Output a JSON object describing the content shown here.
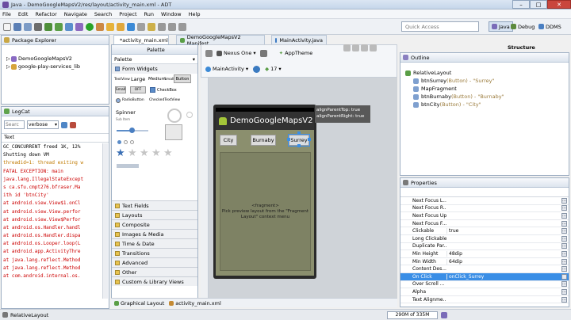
{
  "window": {
    "title": "Java - DemoGoogleMapsV2/res/layout/activity_main.xml - ADT"
  },
  "menu": [
    "File",
    "Edit",
    "Refactor",
    "Navigate",
    "Search",
    "Project",
    "Run",
    "Window",
    "Help"
  ],
  "quick_access": {
    "placeholder": "Quick Access"
  },
  "perspectives": {
    "java": "Java",
    "debug": "Debug",
    "ddms": "DDMS"
  },
  "package_explorer": {
    "title": "Package Explorer",
    "items": [
      "DemoGoogleMapsV2",
      "google-play-services_lib"
    ]
  },
  "logcat": {
    "title": "LogCat",
    "search_placeholder": "Searc",
    "level": "verbose",
    "column": "Text",
    "lines": [
      {
        "text": "GC_CONCURRENT freed 1K, 12%",
        "color": "#000000"
      },
      {
        "text": "Shutting down VM",
        "color": "#000000"
      },
      {
        "text": "threadid=1: thread exiting w",
        "color": "#c07a00"
      },
      {
        "text": "FATAL EXCEPTION: main",
        "color": "#cc0000"
      },
      {
        "text": "java.lang.IllegalStateExcept",
        "color": "#cc0000"
      },
      {
        "text": "s ca.sfu.cmpt276.bfraser.Ma",
        "color": "#cc0000"
      },
      {
        "text": "ith id 'btnCity'",
        "color": "#cc0000"
      },
      {
        "text": "at android.view.View$1.onCl",
        "color": "#cc0000"
      },
      {
        "text": "at android.view.View.perfor",
        "color": "#cc0000"
      },
      {
        "text": "at android.view.View$Perfor",
        "color": "#cc0000"
      },
      {
        "text": "at android.os.Handler.handl",
        "color": "#cc0000"
      },
      {
        "text": "at android.os.Handler.dispa",
        "color": "#cc0000"
      },
      {
        "text": "at android.os.Looper.loop(L",
        "color": "#cc0000"
      },
      {
        "text": "at android.app.ActivityThre",
        "color": "#cc0000"
      },
      {
        "text": "at java.lang.reflect.Method",
        "color": "#cc0000"
      },
      {
        "text": "at java.lang.reflect.Method",
        "color": "#cc0000"
      },
      {
        "text": "at com.android.internal.os.",
        "color": "#cc0000"
      }
    ]
  },
  "editor_tabs": [
    {
      "label": "*activity_main.xml",
      "active": true
    },
    {
      "label": "DemoGoogleMapsV2 Manifest",
      "active": false
    },
    {
      "label": "MainActivity.java",
      "active": false
    }
  ],
  "palette": {
    "header": "Palette",
    "title": "Palette",
    "open_section": "Form Widgets",
    "widget_labels": {
      "textview": "TextView",
      "large": "Large",
      "medium": "Medium",
      "small": "Small",
      "button": "Button",
      "small_btn": "Small",
      "toggle": "OFF",
      "checkbox": "CheckBox",
      "radio": "RadioButton",
      "checked_text": "CheckedTextView",
      "spinner": "Spinner",
      "spinner_sub": "Sub Item"
    },
    "sections": [
      "Text Fields",
      "Layouts",
      "Composite",
      "Images & Media",
      "Time & Date",
      "Transitions",
      "Advanced",
      "Other",
      "Custom & Library Views"
    ]
  },
  "design_toolbar": {
    "device": "Nexus One",
    "theme": "AppTheme",
    "activity": "MainActivity",
    "api": "17"
  },
  "preview": {
    "app_title": "DemoGoogleMapsV2",
    "buttons": [
      "City",
      "Burnaby",
      "Surrey"
    ],
    "fragment_text": "<fragment>\nPick preview layout from the \"Fragment\nLayout\" context menu",
    "tooltip": [
      "alignParentTop: true",
      "alignParentRight: true"
    ]
  },
  "bottom_tabs": [
    "Graphical Layout",
    "activity_main.xml"
  ],
  "structure": {
    "title": "Structure"
  },
  "outline": {
    "title": "Outline",
    "items": [
      {
        "label": "RelativeLayout",
        "detail": "",
        "indent": 0
      },
      {
        "label": "btnSurrey",
        "detail": " (Button) - \"Surrey\"",
        "indent": 1
      },
      {
        "label": "MapFragment",
        "detail": "",
        "indent": 1
      },
      {
        "label": "btnBurnaby",
        "detail": " (Button) - \"Burnaby\"",
        "indent": 1
      },
      {
        "label": "btnCity",
        "detail": " (Button) - \"City\"",
        "indent": 1
      }
    ]
  },
  "properties": {
    "title": "Properties",
    "rows": [
      {
        "name": "Next Focus L...",
        "value": "",
        "selected": false
      },
      {
        "name": "Next Focus R...",
        "value": "",
        "selected": false
      },
      {
        "name": "Next Focus Up",
        "value": "",
        "selected": false
      },
      {
        "name": "Next Focus F...",
        "value": "",
        "selected": false
      },
      {
        "name": "Clickable",
        "value": "true",
        "selected": false
      },
      {
        "name": "Long Clickable",
        "value": "",
        "selected": false
      },
      {
        "name": "Duplicate Par...",
        "value": "",
        "selected": false
      },
      {
        "name": "Min Height",
        "value": "48dip",
        "selected": false
      },
      {
        "name": "Min Width",
        "value": "64dip",
        "selected": false
      },
      {
        "name": "Content Des...",
        "value": "",
        "selected": false
      },
      {
        "name": "On Click",
        "value": "onClick_Surrey",
        "selected": true
      },
      {
        "name": "Over Scroll ...",
        "value": "",
        "selected": false
      },
      {
        "name": "Alpha",
        "value": "",
        "selected": false
      },
      {
        "name": "Text Alignme...",
        "value": "",
        "selected": false
      }
    ]
  },
  "statusbar": {
    "selection": "RelativeLayout",
    "memory": "290M of 335M"
  },
  "colors": {
    "accent": "#3a8ee6",
    "preview_bg": "#8b8f6e",
    "device_title": "#323232"
  }
}
